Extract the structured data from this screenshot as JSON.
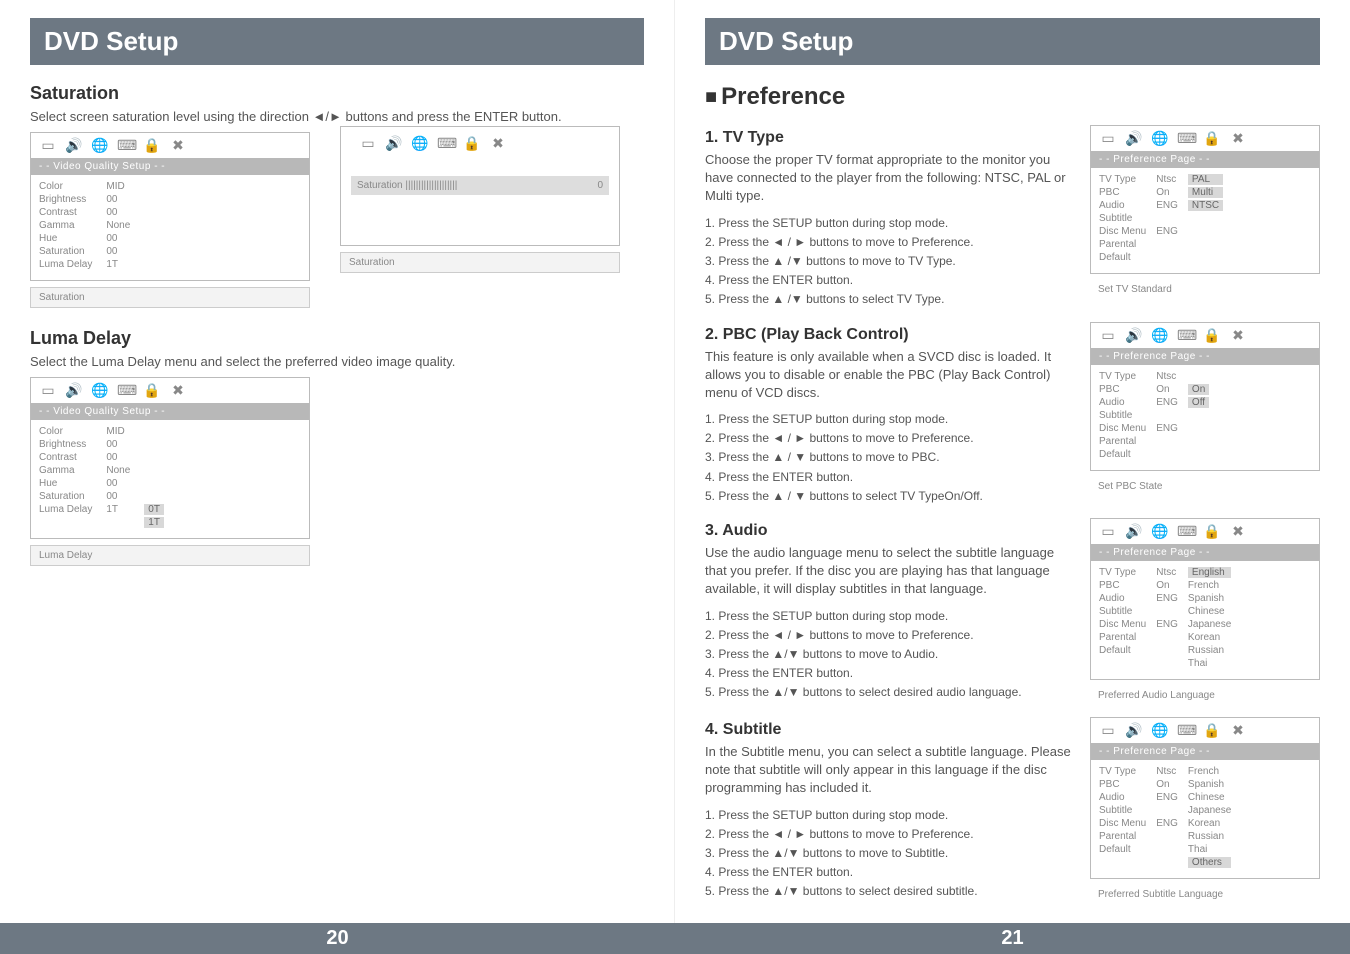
{
  "left": {
    "header": "DVD Setup",
    "saturation": {
      "title": "Saturation",
      "desc": "Select screen saturation level using the direction ◄/► buttons and press the ENTER button.",
      "osd_banner": "- - Video Quality Setup - -",
      "labels": [
        "Color",
        "Brightness",
        "Contrast",
        "Gamma",
        "Hue",
        "Saturation",
        "Luma Delay"
      ],
      "values": [
        "MID",
        "00",
        "00",
        "None",
        "00",
        "00",
        "1T"
      ],
      "caption": "Saturation",
      "slider_label": "Saturation",
      "slider_fill": "||||||||||||||||||||",
      "slider_val": "0",
      "slider_caption": "Saturation"
    },
    "luma": {
      "title": "Luma Delay",
      "desc": "Select the Luma Delay menu and select the preferred video image quality.",
      "osd_banner": "- - Video Quality Setup - -",
      "labels": [
        "Color",
        "Brightness",
        "Contrast",
        "Gamma",
        "Hue",
        "Saturation",
        "Luma Delay"
      ],
      "values": [
        "MID",
        "00",
        "00",
        "None",
        "00",
        "00",
        "1T"
      ],
      "options": [
        "0T",
        "1T"
      ],
      "caption": "Luma Delay"
    },
    "pagenum": "20"
  },
  "right": {
    "header": "DVD Setup",
    "pref_heading": "Preference",
    "tvtype": {
      "title": "1. TV Type",
      "desc": "Choose the proper TV format appropriate to the monitor you have connected to the player from the following: NTSC, PAL or Multi type.",
      "steps": [
        "1. Press the SETUP button during stop mode.",
        "2. Press the ◄ / ► buttons to move to Preference.",
        "3. Press the ▲ /▼ buttons to move to TV Type.",
        "4. Press the ENTER button.",
        "5. Press the ▲ /▼ buttons to select TV Type."
      ],
      "osd_banner": "- - Preference Page - -",
      "labels": [
        "TV Type",
        "PBC",
        "Audio",
        "Subtitle",
        "Disc Menu",
        "Parental",
        "Default"
      ],
      "values": [
        "Ntsc",
        "On",
        "ENG",
        "",
        "ENG",
        "",
        ""
      ],
      "options": [
        "PAL",
        "Multi",
        "NTSC"
      ],
      "caption": "Set TV Standard"
    },
    "pbc": {
      "title": "2. PBC (Play Back Control)",
      "desc": "This feature is only available when a SVCD disc is loaded. It allows you to disable or enable the PBC (Play Back Control) menu of VCD discs.",
      "steps": [
        "1. Press the SETUP button during stop mode.",
        "2. Press the ◄ / ► buttons to move to Preference.",
        "3. Press the ▲ / ▼ buttons to move to PBC.",
        "4. Press the ENTER button.",
        "5. Press the ▲ / ▼ buttons to select TV TypeOn/Off."
      ],
      "osd_banner": "- - Preference Page - -",
      "labels": [
        "TV Type",
        "PBC",
        "Audio",
        "Subtitle",
        "Disc Menu",
        "Parental",
        "Default"
      ],
      "values": [
        "Ntsc",
        "On",
        "ENG",
        "",
        "ENG",
        "",
        ""
      ],
      "options": [
        "On",
        "Off"
      ],
      "caption": "Set PBC State"
    },
    "audio": {
      "title": "3. Audio",
      "desc": "Use the audio language menu to select the subtitle language that you prefer. If the disc you are playing has that language available, it will display subtitles in that language.",
      "steps": [
        "1. Press the SETUP button during stop mode.",
        "2. Press the ◄ / ► buttons to move to Preference.",
        "3. Press the ▲/▼ buttons to move to Audio.",
        "4. Press the ENTER button.",
        "5. Press the ▲/▼ buttons to select desired audio language."
      ],
      "osd_banner": "- - Preference Page - -",
      "labels": [
        "TV Type",
        "PBC",
        "Audio",
        "Subtitle",
        "Disc Menu",
        "Parental",
        "Default"
      ],
      "values": [
        "Ntsc",
        "On",
        "ENG",
        "",
        "ENG",
        "",
        ""
      ],
      "options": [
        "English",
        "French",
        "Spanish",
        "Chinese",
        "Japanese",
        "Korean",
        "Russian",
        "Thai"
      ],
      "caption": "Preferred Audio Language"
    },
    "subtitle": {
      "title": "4. Subtitle",
      "desc": "In the Subtitle menu, you can select a subtitle language. Please note that subtitle will only appear in this language if the disc programming has included it.",
      "steps": [
        "1. Press the SETUP button during stop mode.",
        "2. Press the ◄ / ► buttons to move to Preference.",
        "3. Press the ▲/▼ buttons to move to Subtitle.",
        "4. Press the ENTER button.",
        "5. Press the ▲/▼ buttons to select desired subtitle."
      ],
      "osd_banner": "- - Preference Page - -",
      "labels": [
        "TV Type",
        "PBC",
        "Audio",
        "Subtitle",
        "Disc Menu",
        "Parental",
        "Default"
      ],
      "values": [
        "Ntsc",
        "On",
        "ENG",
        "",
        "ENG",
        "",
        ""
      ],
      "options": [
        "French",
        "Spanish",
        "Chinese",
        "Japanese",
        "Korean",
        "Russian",
        "Thai",
        "Others"
      ],
      "caption": "Preferred Subtitle Language"
    },
    "pagenum": "21"
  }
}
